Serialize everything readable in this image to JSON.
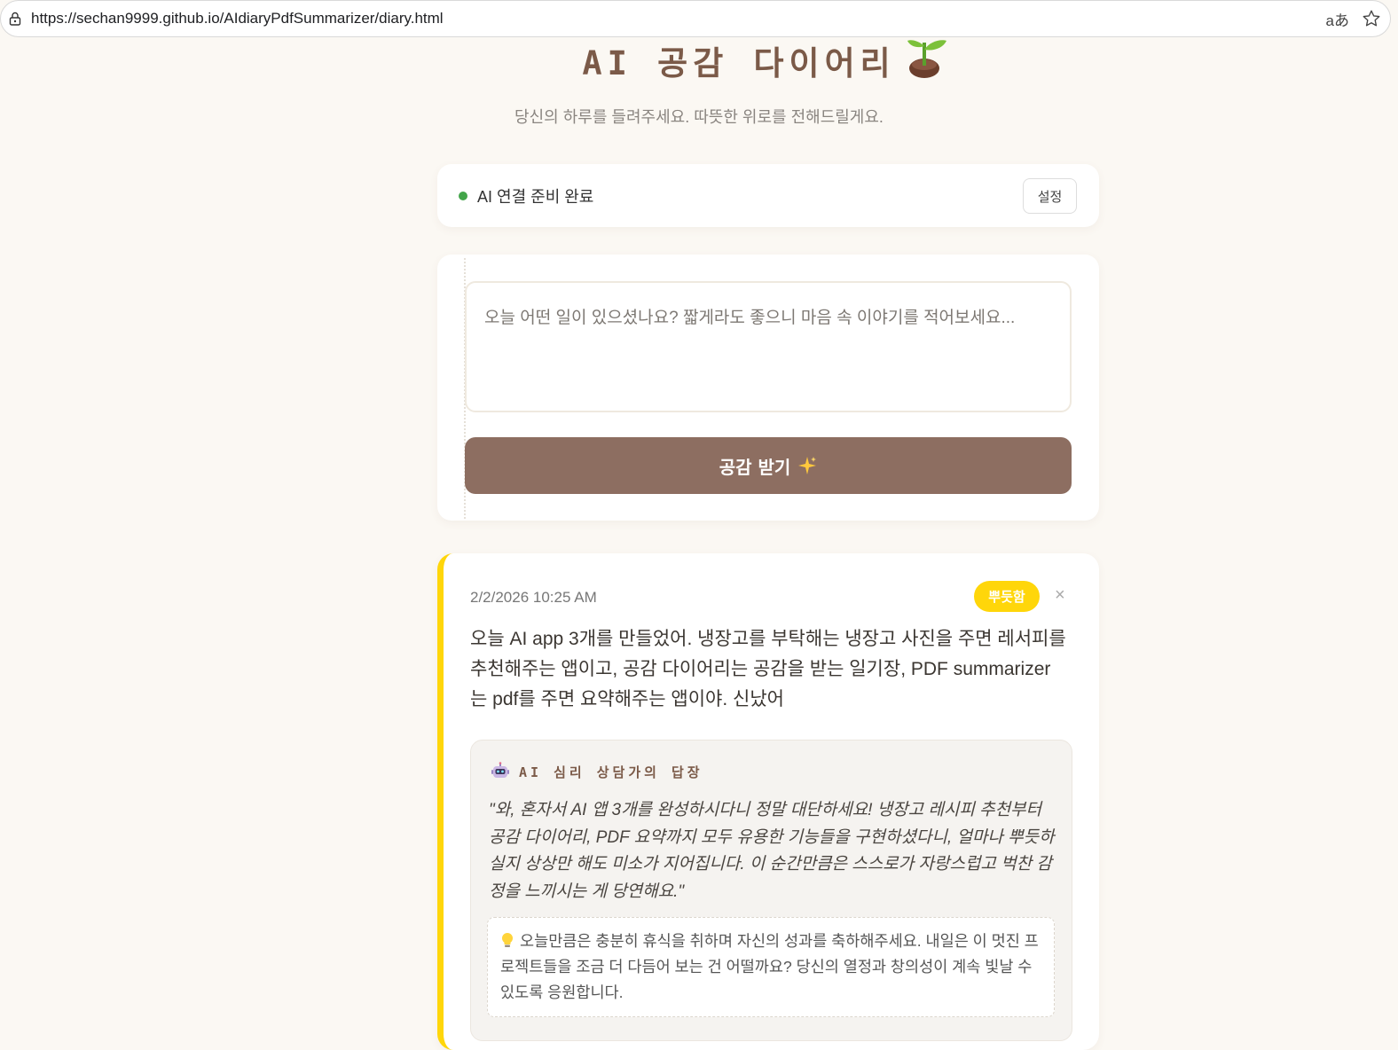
{
  "browser": {
    "url": "https://sechan9999.github.io/AIdiaryPdfSummarizer/diary.html",
    "translate_label": "aあ"
  },
  "header": {
    "title": "AI 공감 다이어리",
    "subtitle": "당신의 하루를 들려주세요. 따뜻한 위로를 전해드릴게요."
  },
  "status": {
    "text": "AI 연결 준비 완료",
    "settings_label": "설정",
    "dot_color": "#43a54a"
  },
  "input": {
    "placeholder": "오늘 어떤 일이 있으셨나요? 짧게라도 좋으니 마음 속 이야기를 적어보세요...",
    "value": "",
    "submit_label": "공감 받기"
  },
  "entry": {
    "date": "2/2/2026 10:25 AM",
    "emotion": "뿌듯함",
    "emotion_color": "#ffd60a",
    "delete_label": "×",
    "text": "오늘 AI app 3개를 만들었어. 냉장고를 부탁해는 냉장고 사진을 주면 레서피를 추천해주는 앱이고, 공감 다이어리는 공감을 받는 일기장, PDF summarizer는 pdf를 주면 요약해주는 앱이야. 신났어",
    "reply": {
      "title": "AI 심리 상담가의 답장",
      "quote": "\"와, 혼자서 AI 앱 3개를 완성하시다니 정말 대단하세요! 냉장고 레시피 추천부터 공감 다이어리, PDF 요약까지 모두 유용한 기능들을 구현하셨다니, 얼마나 뿌듯하실지 상상만 해도 미소가 지어집니다. 이 순간만큼은 스스로가 자랑스럽고 벅찬 감정을 느끼시는 게 당연해요.\"",
      "advice": "오늘만큼은 충분히 휴식을 취하며 자신의 성과를 축하해주세요. 내일은 이 멋진 프로젝트들을 조금 더 다듬어 보는 건 어떨까요? 당신의 열정과 창의성이 계속 빛날 수 있도록 응원합니다."
    }
  },
  "icons": [
    "lock-icon",
    "translate-icon",
    "star-icon",
    "sprout-icon",
    "sparkle-icon",
    "robot-icon",
    "bulb-icon"
  ]
}
